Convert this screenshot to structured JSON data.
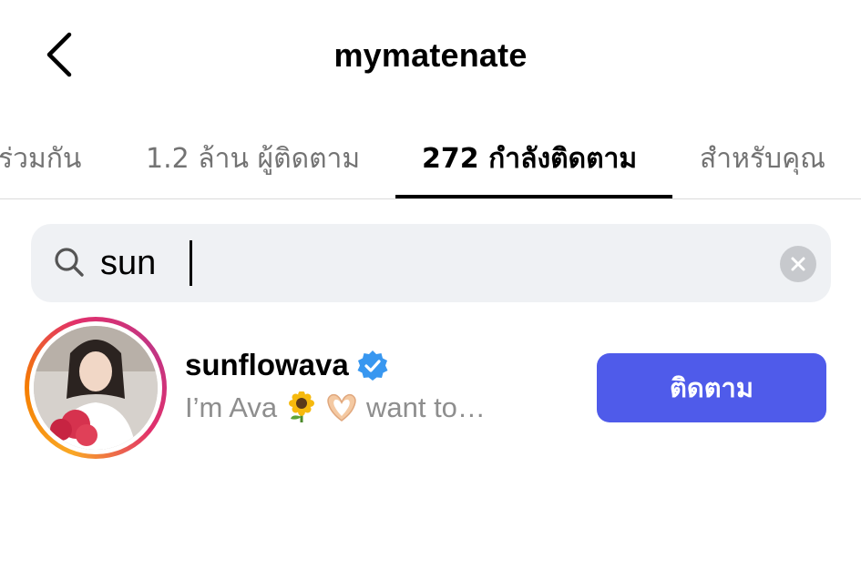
{
  "header": {
    "title": "mymatenate",
    "back_icon": "chevron-left-icon"
  },
  "tabs": [
    {
      "label": "ร่วมกัน",
      "active": false
    },
    {
      "label": "1.2 ล้าน ผู้ติดตาม",
      "active": false
    },
    {
      "label": "272 กำลังติดตาม",
      "active": true
    },
    {
      "label": "สำหรับคุณ",
      "active": false
    }
  ],
  "search": {
    "value": "sun",
    "icon": "search-icon",
    "clear_icon": "close-icon"
  },
  "results": [
    {
      "username": "sunflowava",
      "verified": true,
      "bio_text": "I’m Ava",
      "bio_suffix": "want to…",
      "bio_emojis": [
        "sunflower",
        "heart-hands"
      ],
      "button_label": "ติดตาม"
    }
  ],
  "colors": {
    "accent": "#4f5bea",
    "verified": "#3897f0",
    "muted_text": "#737373",
    "search_bg": "#eff1f4"
  }
}
